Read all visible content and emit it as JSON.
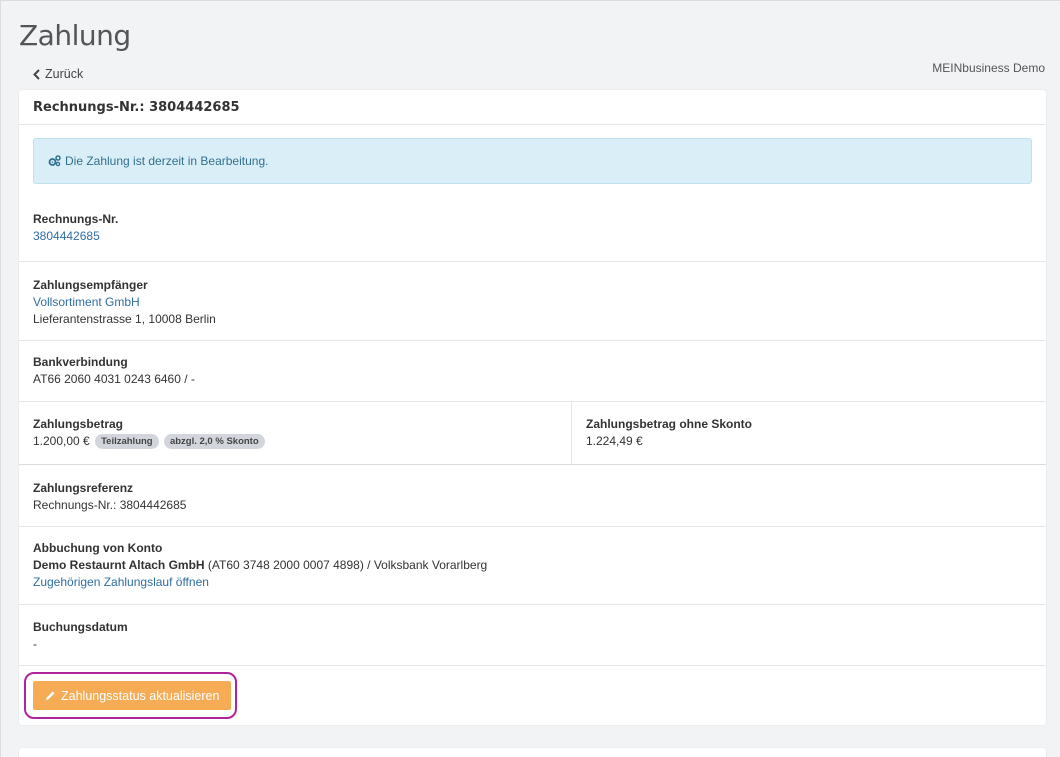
{
  "page": {
    "title": "Zahlung",
    "back_label": "Zurück",
    "tenant": "MEINbusiness Demo"
  },
  "card": {
    "header": "Rechnungs-Nr.: 3804442685",
    "alert": "Die Zahlung ist derzeit in Bearbeitung.",
    "invoice": {
      "label": "Rechnungs-Nr.",
      "value": "3804442685"
    },
    "payee": {
      "label": "Zahlungsempfänger",
      "name": "Vollsortiment GmbH",
      "address": "Lieferantenstrasse 1, 10008 Berlin"
    },
    "bank": {
      "label": "Bankverbindung",
      "value": "AT66 2060 4031 0243 6460 / -"
    },
    "amount": {
      "label": "Zahlungsbetrag",
      "value": "1.200,00 €",
      "badge_partial": "Teilzahlung",
      "badge_discount": "abzgl. 2,0 % Skonto"
    },
    "amount_no_discount": {
      "label": "Zahlungsbetrag ohne Skonto",
      "value": "1.224,49 €"
    },
    "reference": {
      "label": "Zahlungsreferenz",
      "value": "Rechnungs-Nr.: 3804442685"
    },
    "debit": {
      "label": "Abbuchung von Konto",
      "account_name": "Demo Restaurnt Altach GmbH",
      "account_detail": " (AT60 3748 2000 0007 4898) / Volksbank Vorarlberg",
      "run_link": "Zugehörigen Zahlungslauf öffnen"
    },
    "booking_date": {
      "label": "Buchungsdatum",
      "value": "-"
    },
    "update_button": "Zahlungsstatus aktualisieren"
  },
  "colors": {
    "accent_button": "#f6ab55",
    "alert_bg": "#d9eef6",
    "link": "#2f6ea3",
    "highlight": "#b0239a"
  }
}
